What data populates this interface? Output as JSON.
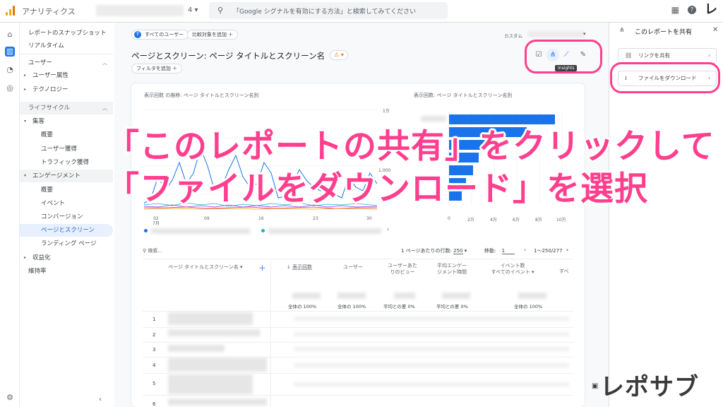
{
  "topbar": {
    "app_name": "アナリティクス",
    "property_suffix": "4",
    "search_placeholder": "「Google シグナルを有効にする方法」と検索してみてください",
    "brand_glyph": "レ"
  },
  "nav": {
    "snapshot": "レポートのスナップショット",
    "realtime": "リアルタイム",
    "user_section": "ユーザー",
    "user_attr": "ユーザー属性",
    "tech": "テクノロジー",
    "lifecycle_section": "ライフサイクル",
    "acquisition": "集客",
    "overview1": "概要",
    "user_acq": "ユーザー獲得",
    "traffic_acq": "トラフィック獲得",
    "engagement": "エンゲージメント",
    "overview2": "概要",
    "events": "イベント",
    "conversions": "コンバージョン",
    "pages": "ページとスクリーン",
    "landing": "ランディング ページ",
    "monetization": "収益化",
    "retention": "維持率"
  },
  "main": {
    "all_users_chip": "すべてのユーザー",
    "compare_chip": "比較対象を追加",
    "title": "ページとスクリーン: ページ タイトルとスクリーン名",
    "filter_chip": "フィルタを追加",
    "custom_label": "カスタム",
    "tooltip": "Insights",
    "chart_left_title": "表示回数 の推移: ページ タイトルとスクリーン名別",
    "chart_right_title": "表示回数: ページ タイトルとスクリーン名別",
    "x_ticks": [
      "02\n7月",
      "09",
      "16",
      "23",
      "30"
    ],
    "y_ticks_left": [
      "1万",
      "1,000"
    ],
    "bar_x_ticks": [
      "0",
      "2万",
      "4万",
      "6万",
      "8万",
      "10万"
    ],
    "search_ph": "検索...",
    "rows_per_page_label": "1 ページあたりの行数:",
    "rows_per_page": "250",
    "goto_label": "移動:",
    "goto_value": "1",
    "range_label": "1〜250/277",
    "col_dim": "ページ タイトルとスクリーン名",
    "col_views": "表示回数",
    "col_users": "ユーザー",
    "col_vpu": "ユーザーあたりのビュー",
    "col_eng": "平均エンゲージメント時間",
    "col_evt": "イベント数",
    "col_evt_sub": "すべてのイベント",
    "col_more": "すべ",
    "sum_total1": "全体の 100%",
    "sum_total2": "全体の 100%",
    "sum_avg1": "平均との差 0%",
    "sum_avg2": "平均との差 0%",
    "sum_total3": "全体の 100%",
    "row_numbers": [
      "1",
      "2",
      "3",
      "4",
      "5",
      "6"
    ]
  },
  "panel": {
    "title": "このレポートを共有",
    "share_link": "リンクを共有",
    "download": "ファイルをダウンロード"
  },
  "overlay": {
    "line1": "「このレポートの共有」をクリックして",
    "line2": "「ファイルをダウンロード」を選択",
    "brand": "レポサブ",
    "accent": "#ff3f8e"
  }
}
